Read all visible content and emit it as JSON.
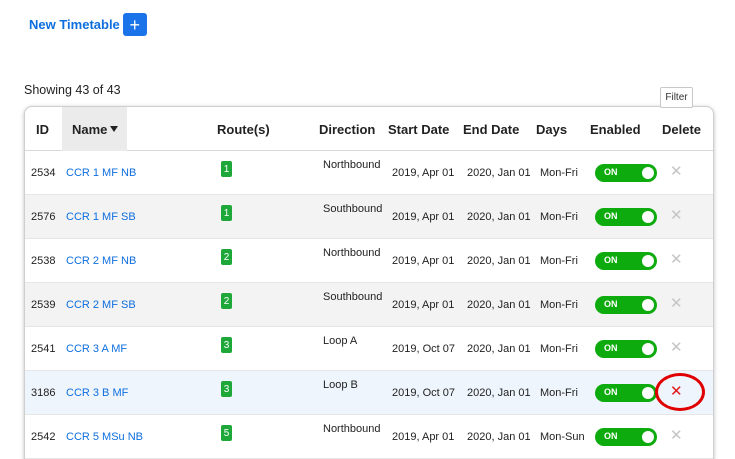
{
  "new_timetable": {
    "label": "New Timetable",
    "plus": "+"
  },
  "showing": "Showing 43 of 43",
  "filter_label": "Filter",
  "headers": {
    "id": "ID",
    "name": "Name",
    "routes": "Route(s)",
    "direction": "Direction",
    "start_date": "Start Date",
    "end_date": "End Date",
    "days": "Days",
    "enabled": "Enabled",
    "delete": "Delete"
  },
  "toggle_label": "ON",
  "delete_glyph": "✕",
  "rows": [
    {
      "id": "2534",
      "name": "CCR 1 MF NB",
      "route": "1",
      "direction": "Northbound",
      "start": "2019, Apr 01",
      "end": "2020, Jan 01",
      "days": "Mon-Fri"
    },
    {
      "id": "2576",
      "name": "CCR 1 MF SB",
      "route": "1",
      "direction": "Southbound",
      "start": "2019, Apr 01",
      "end": "2020, Jan 01",
      "days": "Mon-Fri"
    },
    {
      "id": "2538",
      "name": "CCR 2 MF NB",
      "route": "2",
      "direction": "Northbound",
      "start": "2019, Apr 01",
      "end": "2020, Jan 01",
      "days": "Mon-Fri"
    },
    {
      "id": "2539",
      "name": "CCR 2 MF SB",
      "route": "2",
      "direction": "Southbound",
      "start": "2019, Apr 01",
      "end": "2020, Jan 01",
      "days": "Mon-Fri"
    },
    {
      "id": "2541",
      "name": "CCR 3 A MF",
      "route": "3",
      "direction": "Loop A",
      "start": "2019, Oct 07",
      "end": "2020, Jan 01",
      "days": "Mon-Fri"
    },
    {
      "id": "3186",
      "name": "CCR 3 B MF",
      "route": "3",
      "direction": "Loop B",
      "start": "2019, Oct 07",
      "end": "2020, Jan 01",
      "days": "Mon-Fri"
    },
    {
      "id": "2542",
      "name": "CCR 5 MSu NB",
      "route": "5",
      "direction": "Northbound",
      "start": "2019, Apr 01",
      "end": "2020, Jan 01",
      "days": "Mon-Sun"
    }
  ]
}
